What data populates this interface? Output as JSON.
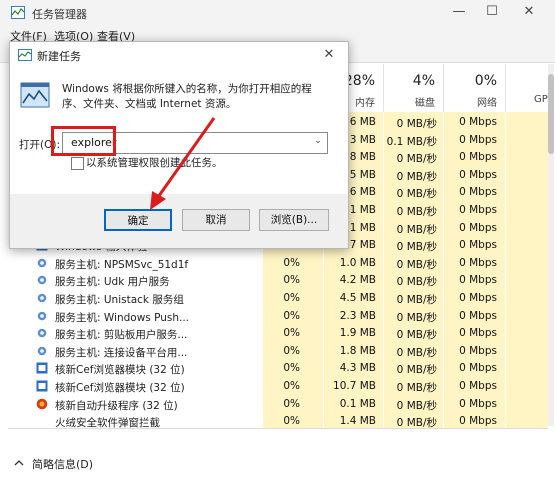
{
  "window": {
    "title": "任务管理器"
  },
  "menubar": {
    "items": [
      "文件(F)",
      "选项(O)",
      "查看(V)"
    ]
  },
  "columns": [
    {
      "pct": "28%",
      "name": "内存"
    },
    {
      "pct": "4%",
      "name": "磁盘"
    },
    {
      "pct": "0%",
      "name": "网络"
    },
    {
      "pct": "",
      "name": "GP"
    }
  ],
  "rows": [
    {
      "name": "",
      "cpu": "",
      "mem": "3.6 MB",
      "disk": "0 MB/秒",
      "net": "0 Mbps",
      "icon": "blank"
    },
    {
      "name": "",
      "cpu": "",
      "mem": "8.3 MB",
      "disk": "0.1 MB/秒",
      "net": "0 Mbps",
      "icon": "blank"
    },
    {
      "name": "",
      "cpu": "",
      "mem": "8.8 MB",
      "disk": "0 MB/秒",
      "net": "0 Mbps",
      "icon": "blank"
    },
    {
      "name": "",
      "cpu": "",
      "mem": "3.5 MB",
      "disk": "0 MB/秒",
      "net": "0 Mbps",
      "icon": "blank"
    },
    {
      "name": "",
      "cpu": "",
      "mem": "5.6 MB",
      "disk": "0 MB/秒",
      "net": "0 Mbps",
      "icon": "blank"
    },
    {
      "name": "",
      "cpu": "",
      "mem": "3.1 MB",
      "disk": "0 MB/秒",
      "net": "0 Mbps",
      "icon": "blank"
    },
    {
      "name": "",
      "cpu": "",
      "mem": "3.1 MB",
      "disk": "0 MB/秒",
      "net": "0 Mbps",
      "icon": "blank"
    },
    {
      "name": "Windows 输入体验",
      "cpu": "",
      "mem": "11.7 MB",
      "disk": "0 MB/秒",
      "net": "0 Mbps",
      "icon": "blue"
    },
    {
      "name": "服务主机: NPSMSvc_51d1f",
      "cpu": "0%",
      "mem": "1.0 MB",
      "disk": "0 MB/秒",
      "net": "0 Mbps",
      "icon": "gear"
    },
    {
      "name": "服务主机: Udk 用户服务",
      "cpu": "0%",
      "mem": "4.2 MB",
      "disk": "0 MB/秒",
      "net": "0 Mbps",
      "icon": "gear"
    },
    {
      "name": "服务主机: Unistack 服务组",
      "cpu": "0%",
      "mem": "4.5 MB",
      "disk": "0 MB/秒",
      "net": "0 Mbps",
      "icon": "gear"
    },
    {
      "name": "服务主机: Windows Push...",
      "cpu": "0%",
      "mem": "2.3 MB",
      "disk": "0 MB/秒",
      "net": "0 Mbps",
      "icon": "gear"
    },
    {
      "name": "服务主机: 剪贴板用户服务...",
      "cpu": "0%",
      "mem": "1.9 MB",
      "disk": "0 MB/秒",
      "net": "0 Mbps",
      "icon": "gear"
    },
    {
      "name": "服务主机: 连接设备平台用...",
      "cpu": "0%",
      "mem": "1.8 MB",
      "disk": "0 MB/秒",
      "net": "0 Mbps",
      "icon": "gear"
    },
    {
      "name": "核新Cef浏览器模块 (32 位)",
      "cpu": "0%",
      "mem": "4.3 MB",
      "disk": "0 MB/秒",
      "net": "0 Mbps",
      "icon": "blue"
    },
    {
      "name": "核新Cef浏览器模块 (32 位)",
      "cpu": "0%",
      "mem": "10.7 MB",
      "disk": "0 MB/秒",
      "net": "0 Mbps",
      "icon": "blue"
    },
    {
      "name": "核新自动升级程序 (32 位)",
      "cpu": "0%",
      "mem": "0.1 MB",
      "disk": "0 MB/秒",
      "net": "0 Mbps",
      "icon": "red"
    },
    {
      "name": "火绒安全软件弹窗拦截",
      "cpu": "0%",
      "mem": "1.4 MB",
      "disk": "0 MB/秒",
      "net": "0 Mbps",
      "icon": "blank"
    }
  ],
  "footer": {
    "summary_label": "简略信息(D)"
  },
  "dialog": {
    "title": "新建任务",
    "description": "Windows 将根据你所键入的名称，为你打开相应的程序、文件夹、文档或 Internet 资源。",
    "open_label": "打开(O):",
    "open_value": "explorer",
    "admin_label": "以系统管理权限创建此任务。",
    "ok_label": "确定",
    "cancel_label": "取消",
    "browse_label": "浏览(B)..."
  },
  "colors": {
    "highlight": "#d91c1c",
    "accent": "#0067c0",
    "heat": "#fff4c4"
  }
}
